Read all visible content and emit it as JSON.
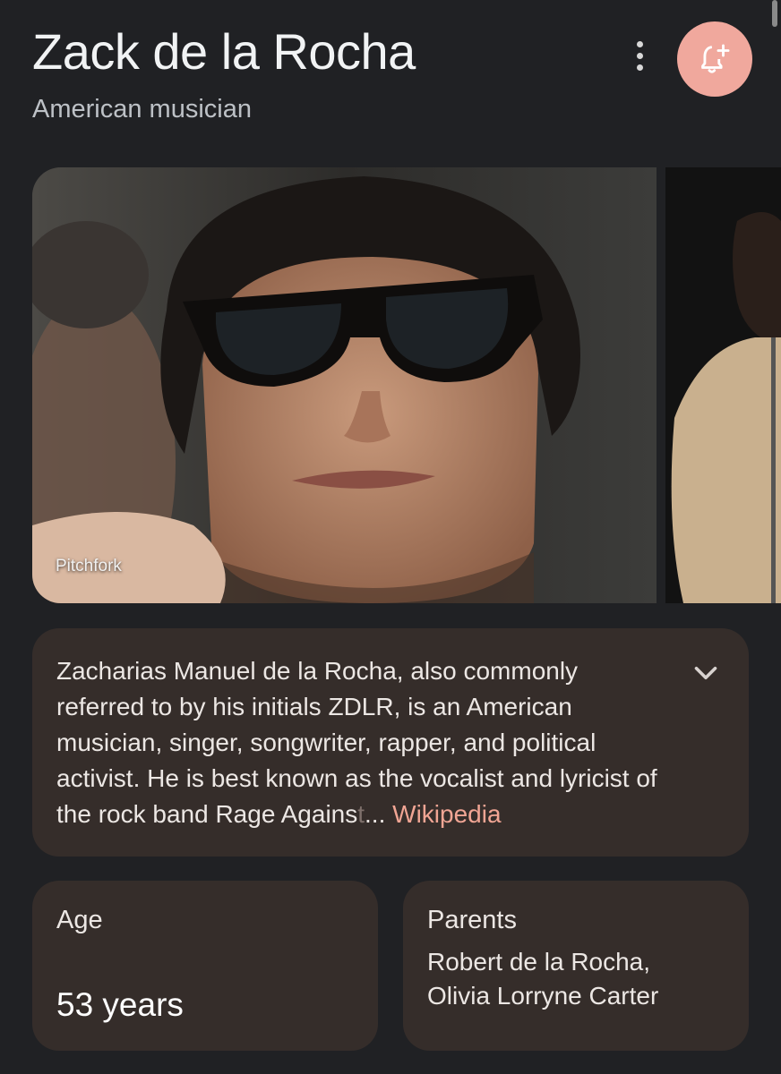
{
  "header": {
    "title": "Zack de la Rocha",
    "subtitle": "American musician"
  },
  "actions": {
    "more_icon": "more-vert-icon",
    "follow_icon": "bell-plus-icon",
    "accent": "#f0a89d"
  },
  "images": {
    "main_source": "Pitchfork"
  },
  "description": {
    "text": "Zacharias Manuel de la Rocha, also commonly referred to by his initials ZDLR, is an American musician, singer, songwriter, rapper, and political activist. He is best known as the vocalist and lyricist of the rock band Rage Agains",
    "fade": "t",
    "ellipsis": "...",
    "source": "Wikipedia",
    "expand_icon": "chevron-down-icon"
  },
  "facts": {
    "age_label": "Age",
    "age_value": "53 years",
    "parents_label": "Parents",
    "parents_line1": "Robert de la Rocha,",
    "parents_line2": "Olivia Lorryne Carter"
  }
}
